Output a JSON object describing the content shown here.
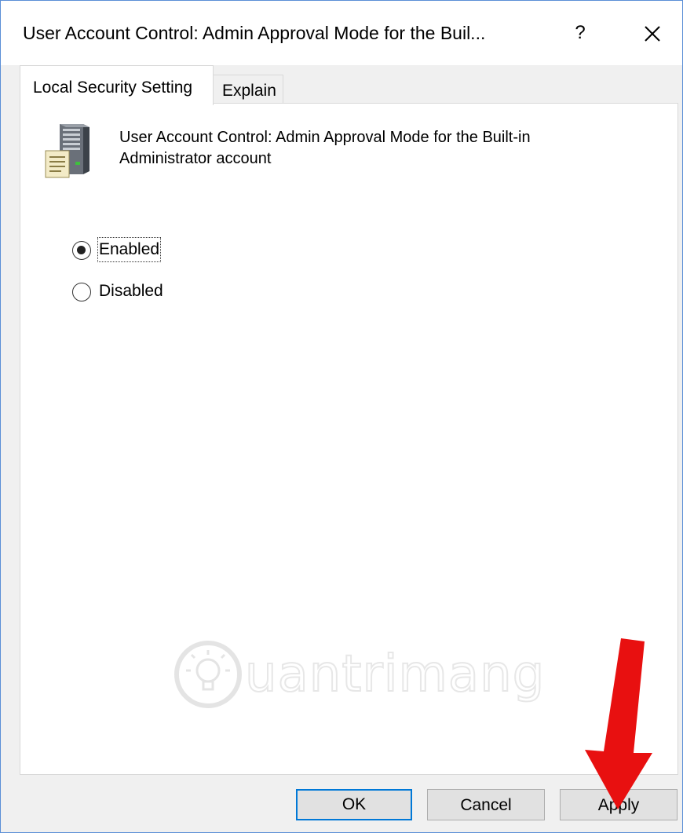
{
  "window": {
    "title": "User Account Control: Admin Approval Mode for the Buil...",
    "help_glyph": "?",
    "close_glyph": "✕"
  },
  "tabs": [
    {
      "label": "Local Security Setting",
      "active": true
    },
    {
      "label": "Explain",
      "active": false
    }
  ],
  "policy": {
    "icon": "server-document-icon",
    "name": "User Account Control: Admin Approval Mode for the Built-in Administrator account"
  },
  "options": [
    {
      "label": "Enabled",
      "checked": true
    },
    {
      "label": "Disabled",
      "checked": false
    }
  ],
  "buttons": {
    "ok": "OK",
    "cancel": "Cancel",
    "apply": "Apply"
  },
  "watermark": {
    "text": "uantrimang"
  },
  "colors": {
    "accent": "#0078d7",
    "window_border": "#5b8fd6",
    "annotation_arrow": "#e81010"
  }
}
